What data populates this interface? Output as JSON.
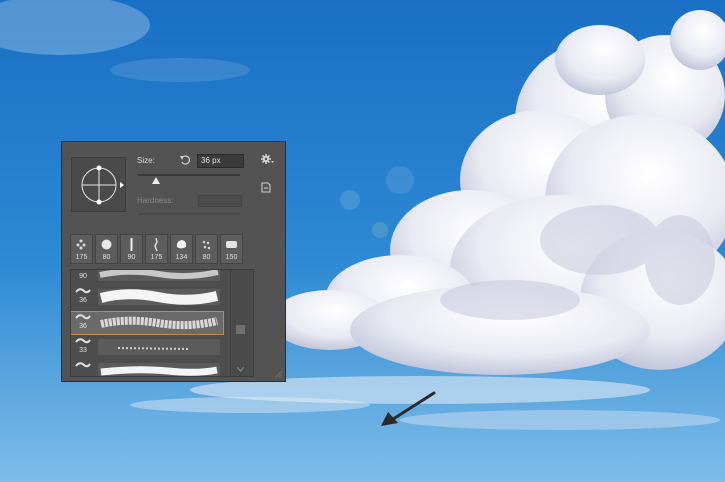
{
  "brush_panel": {
    "size_label": "Size:",
    "size_value": "36 px",
    "size_level_fraction": 0.18,
    "hardness_label": "Hardness:",
    "recent_brushes": [
      "175",
      "80",
      "90",
      "175",
      "134",
      "80",
      "150"
    ],
    "brush_list": [
      {
        "number": "90",
        "selected": false
      },
      {
        "number": "36",
        "selected": false
      },
      {
        "number": "36",
        "selected": true
      },
      {
        "number": "33",
        "selected": false
      },
      {
        "number": "",
        "selected": false
      }
    ]
  },
  "icons": {
    "reset": "reset-icon",
    "settings": "gear-icon",
    "new_preset": "new-preset-icon",
    "arrow": "arrow-pointer"
  },
  "colors": {
    "sky_top": "#1e74c6",
    "sky_bottom": "#6fb3e5",
    "panel_bg": "#535353",
    "selection": "#d08a2b"
  }
}
